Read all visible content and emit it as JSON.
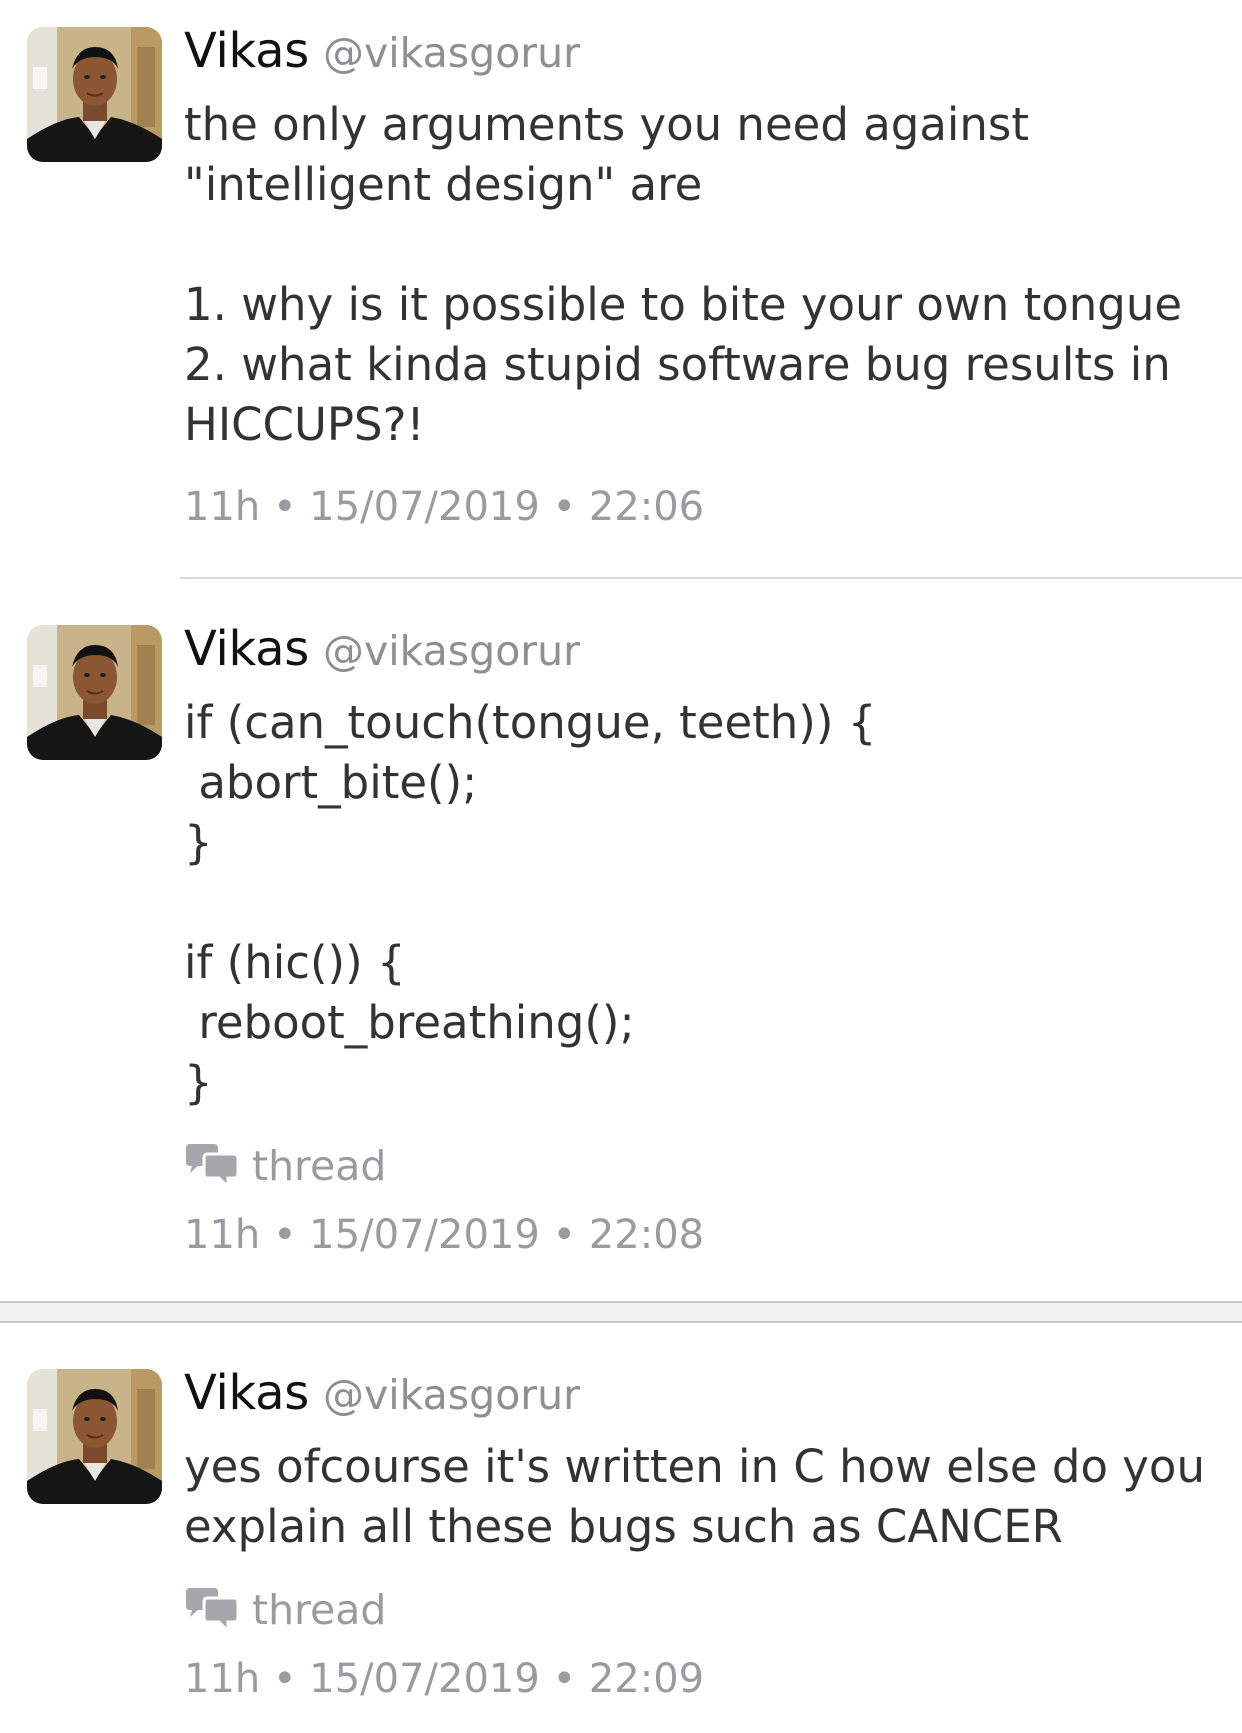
{
  "tweets": [
    {
      "name": "Vikas",
      "handle": "@vikasgorur",
      "text": "the only arguments you need against\n\"intelligent design\" are\n\n1. why is it possible to bite your own tongue\n2. what kinda stupid software bug results in\nHICCUPS?!",
      "meta": "11h • 15/07/2019 • 22:06"
    },
    {
      "name": "Vikas",
      "handle": "@vikasgorur",
      "text": "if (can_touch(tongue, teeth)) {\n abort_bite();\n}\n\nif (hic()) {\n reboot_breathing();\n}",
      "thread_label": "thread",
      "meta": "11h • 15/07/2019 • 22:08"
    },
    {
      "name": "Vikas",
      "handle": "@vikasgorur",
      "text": "yes ofcourse it's written in C how else do you\nexplain all these bugs such as CANCER",
      "thread_label": "thread",
      "meta": "11h • 15/07/2019 • 22:09"
    }
  ],
  "icons": {
    "avatar": "avatar-photo",
    "thread": "speech-bubbles-icon"
  },
  "colors": {
    "secondary_text": "#9a9aa0",
    "separator": "#d8d8dc"
  }
}
